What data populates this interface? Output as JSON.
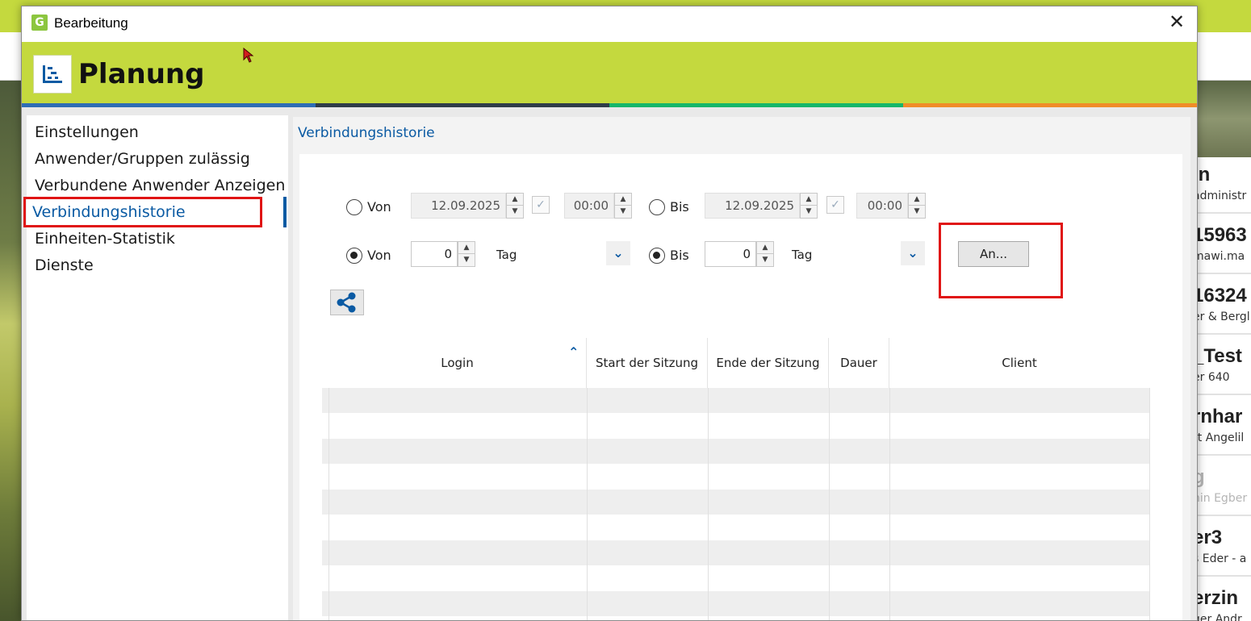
{
  "dialog": {
    "title": "Bearbeitung",
    "banner_title": "Planung",
    "stripe_colors": [
      "#2e6db4",
      "#2f3c48",
      "#16b66a",
      "#f08c28"
    ],
    "close_icon": "close-icon"
  },
  "nav": {
    "items": [
      {
        "label": "Einstellungen"
      },
      {
        "label": "Anwender/Gruppen zulässig"
      },
      {
        "label": "Verbundene Anwender Anzeigen"
      },
      {
        "label": "Verbindungshistorie",
        "active": true
      },
      {
        "label": "Einheiten-Statistik"
      },
      {
        "label": "Dienste"
      }
    ]
  },
  "content": {
    "header": "Verbindungshistorie",
    "row1": {
      "from_label": "Von",
      "from_date": "12.09.2025",
      "from_time": "00:00",
      "to_label": "Bis",
      "to_date": "12.09.2025",
      "to_time": "00:00"
    },
    "row2": {
      "from_label": "Von",
      "from_value": "0",
      "from_unit": "Tag",
      "to_label": "Bis",
      "to_value": "0",
      "to_unit": "Tag",
      "apply_button": "An..."
    },
    "table": {
      "columns": [
        "Login",
        "Start der Sitzung",
        "Ende der Sitzung",
        "Dauer",
        "Client"
      ],
      "rows": []
    }
  },
  "background": {
    "cards": [
      {
        "big": "in",
        "small": "administr"
      },
      {
        "big": "15963",
        "small": "mawi.ma"
      },
      {
        "big": "16324",
        "small": "er & Bergl"
      },
      {
        "big": "_Test",
        "small": "er 640"
      },
      {
        "big": "rnhar",
        "small": "rt Angelil"
      },
      {
        "big": "g",
        "small": "nin Egber",
        "faded": true
      },
      {
        "big": "er3",
        "small": "s Eder - a"
      },
      {
        "big": "erzin",
        "small": "ger Andr"
      }
    ]
  },
  "colors": {
    "brand_green": "#c4d93e",
    "accent_blue": "#0a5aa3",
    "highlight_red": "#e01414"
  }
}
